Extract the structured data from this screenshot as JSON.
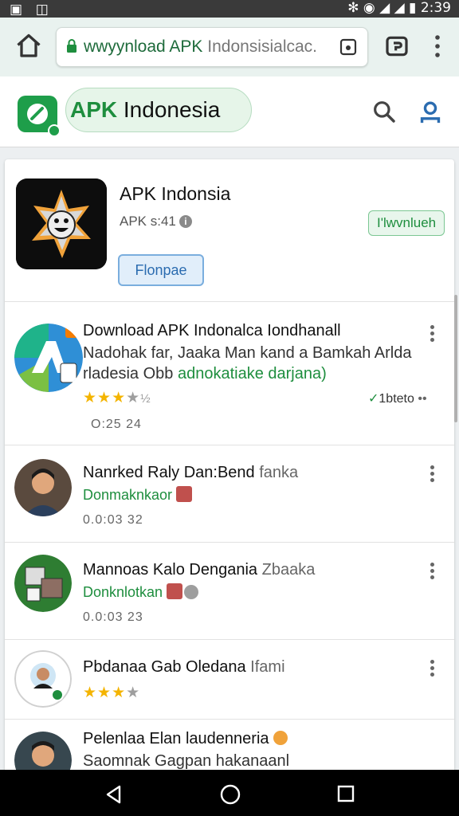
{
  "status_bar": {
    "time": "2:39"
  },
  "browser": {
    "url_domain": "wwyynload APK",
    "url_rest": " Indonsisialcac."
  },
  "header": {
    "brand_apk": "APK",
    "brand_rest": " Indonesia"
  },
  "app": {
    "name": "APK Indonsia",
    "subtitle": "APK s:41",
    "download_label": "I'lwvnlueh",
    "follow_label": "Flonpae"
  },
  "feed": [
    {
      "title": "Download APK Indonalca Iondhanall",
      "desc1": "Nadohak far, Jaaka Man kand a Bamkah Arlda",
      "desc2_plain": "rladesia Obb ",
      "desc2_green": "adnokatiake darjana)",
      "rating_on": 3,
      "rating_off": 2,
      "stat": "1bteto",
      "meta": "O:25 24"
    },
    {
      "title": "Nanrked Raly Dan:Bend ",
      "title_lite": "fanka",
      "sub": "Donmaknkaor",
      "meta": "0.0:03 32"
    },
    {
      "title": "Mannoas Kalo Dengania ",
      "title_lite": "Zbaaka",
      "sub": "Donknlotkan",
      "meta": "0.0:03 23"
    },
    {
      "title": "Pbdanaa Gab Oledana ",
      "title_lite": "Ifami",
      "rating_on": 3,
      "rating_off": 1
    },
    {
      "title": "Pelenlaa Elan laudenneria",
      "sub": "Saomnak Gagpan hakanaanl"
    }
  ],
  "icons": [
    "home-icon",
    "lock-icon",
    "tab-icon",
    "extension-icon",
    "overflow-menu-icon",
    "search-icon",
    "account-icon",
    "back-icon",
    "home-circle-icon",
    "recents-icon"
  ],
  "colors": {
    "accent_green": "#1e8e3e",
    "link_blue": "#2b6cb0",
    "star": "#f4b400"
  }
}
